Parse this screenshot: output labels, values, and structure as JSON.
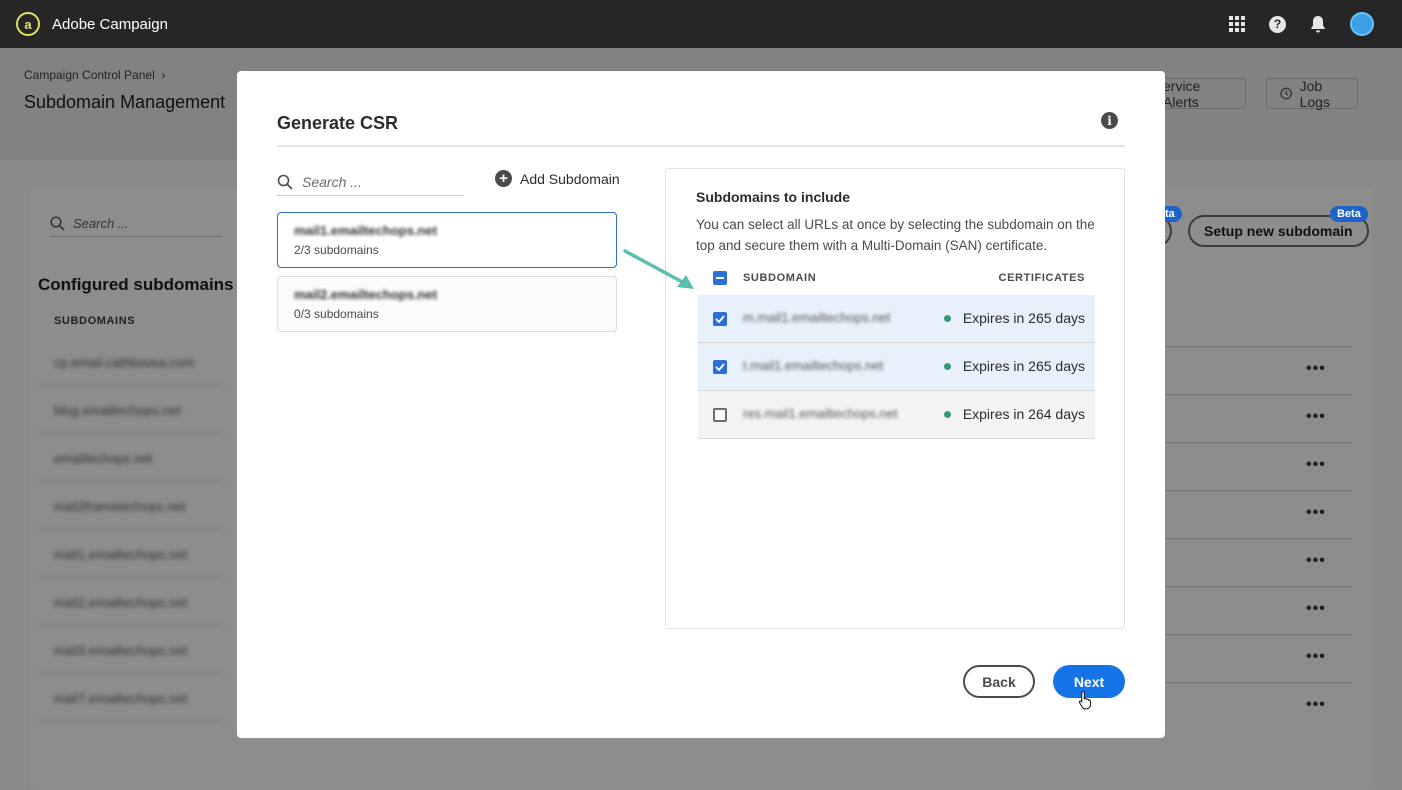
{
  "topbar": {
    "app_name": "Adobe Campaign",
    "logo_glyph": "a"
  },
  "background": {
    "breadcrumb": "Campaign Control Panel",
    "breadcrumb_sep": "›",
    "page_title": "Subdomain Management",
    "service_alerts_label": "ervice Alerts",
    "job_logs_label": "Job Logs",
    "search_placeholder": "Search ...",
    "section_title": "Configured subdomains",
    "column_header": "SUBDOMAINS",
    "rows": [
      "cp.email.cathbovea.com",
      "blog.emailtechops.net",
      "emailtechops.net",
      "mail2frametechops.net",
      "mail1.emailtechops.net",
      "mail2.emailtechops.net",
      "mail3.emailtechops.net",
      "mail7.emailtechops.net"
    ],
    "setup_button": "Setup new subdomain",
    "beta_label": "Beta",
    "beta_partial": "ta",
    "more_glyph": "•••"
  },
  "modal": {
    "title": "Generate CSR",
    "info_glyph": "i",
    "search_placeholder": "Search ...",
    "add_subdomain_label": "Add Subdomain",
    "domains": [
      {
        "name": "mail1.emailtechops.net",
        "count": "2/3 subdomains",
        "selected": true
      },
      {
        "name": "mail2.emailtechops.net",
        "count": "0/3 subdomains",
        "selected": false
      }
    ],
    "panel": {
      "title": "Subdomains to include",
      "description": "You can select all URLs at once by selecting the subdomain on the top and secure them with a Multi-Domain (SAN) certificate.",
      "col_subdomain": "SUBDOMAIN",
      "col_certificates": "CERTIFICATES",
      "rows": [
        {
          "name": "m.mail1.emailtechops.net",
          "expiry": "Expires in 265 days",
          "checked": true
        },
        {
          "name": "t.mail1.emailtechops.net",
          "expiry": "Expires in 265 days",
          "checked": true
        },
        {
          "name": "res.mail1.emailtechops.net",
          "expiry": "Expires in 264 days",
          "checked": false
        }
      ]
    },
    "back_label": "Back",
    "next_label": "Next"
  },
  "colors": {
    "accent": "#1473e6",
    "status_ok": "#2d9d78",
    "annotation_arrow": "#5bbfae"
  }
}
